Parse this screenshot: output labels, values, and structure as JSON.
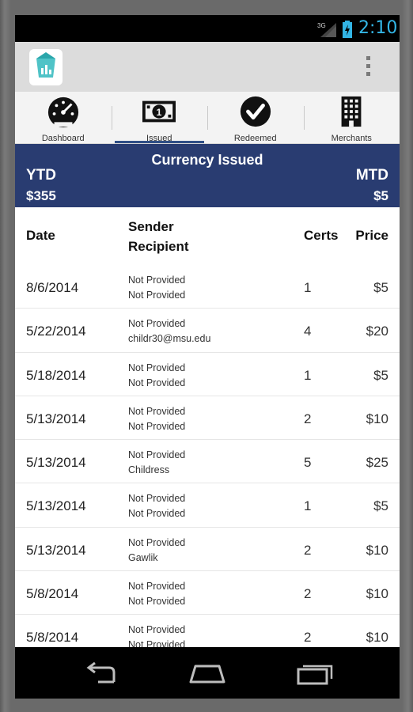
{
  "status_bar": {
    "network": "3G",
    "time": "2:10",
    "signal_icon": "signal-icon",
    "battery_icon": "battery-charging-icon"
  },
  "action_bar": {
    "app_icon": "app-logo-icon",
    "overflow_icon": "overflow-menu-icon"
  },
  "tabs": [
    {
      "label": "Dashboard",
      "icon": "speedometer-icon",
      "active": false
    },
    {
      "label": "Issued",
      "icon": "dollar-bill-icon",
      "active": true
    },
    {
      "label": "Redeemed",
      "icon": "checkmark-circle-icon",
      "active": false
    },
    {
      "label": "Merchants",
      "icon": "building-icon",
      "active": false
    }
  ],
  "banner": {
    "title": "Currency Issued",
    "ytd_label": "YTD",
    "ytd_value": "$355",
    "mtd_label": "MTD",
    "mtd_value": "$5"
  },
  "table": {
    "headers": {
      "date": "Date",
      "sender": "Sender",
      "recipient": "Recipient",
      "certs": "Certs",
      "price": "Price"
    },
    "rows": [
      {
        "date": "8/6/2014",
        "sender": "Not Provided",
        "recipient": "Not Provided",
        "certs": "1",
        "price": "$5"
      },
      {
        "date": "5/22/2014",
        "sender": "Not Provided",
        "recipient": "childr30@msu.edu",
        "certs": "4",
        "price": "$20"
      },
      {
        "date": "5/18/2014",
        "sender": "Not Provided",
        "recipient": "Not Provided",
        "certs": "1",
        "price": "$5"
      },
      {
        "date": "5/13/2014",
        "sender": "Not Provided",
        "recipient": "Not Provided",
        "certs": "2",
        "price": "$10"
      },
      {
        "date": "5/13/2014",
        "sender": "Not Provided",
        "recipient": "Childress",
        "certs": "5",
        "price": "$25"
      },
      {
        "date": "5/13/2014",
        "sender": "Not Provided",
        "recipient": "Not Provided",
        "certs": "1",
        "price": "$5"
      },
      {
        "date": "5/13/2014",
        "sender": "Not Provided",
        "recipient": "Gawlik",
        "certs": "2",
        "price": "$10"
      },
      {
        "date": "5/8/2014",
        "sender": "Not Provided",
        "recipient": "Not Provided",
        "certs": "2",
        "price": "$10"
      },
      {
        "date": "5/8/2014",
        "sender": "Not Provided",
        "recipient": "Not Provided",
        "certs": "2",
        "price": "$10"
      }
    ]
  },
  "nav_bar": {
    "back_icon": "back-icon",
    "home_icon": "home-icon",
    "recents_icon": "recent-apps-icon"
  },
  "colors": {
    "banner": "#293c71",
    "accent": "#33b5e5",
    "tab_indicator": "#2f4f86"
  }
}
